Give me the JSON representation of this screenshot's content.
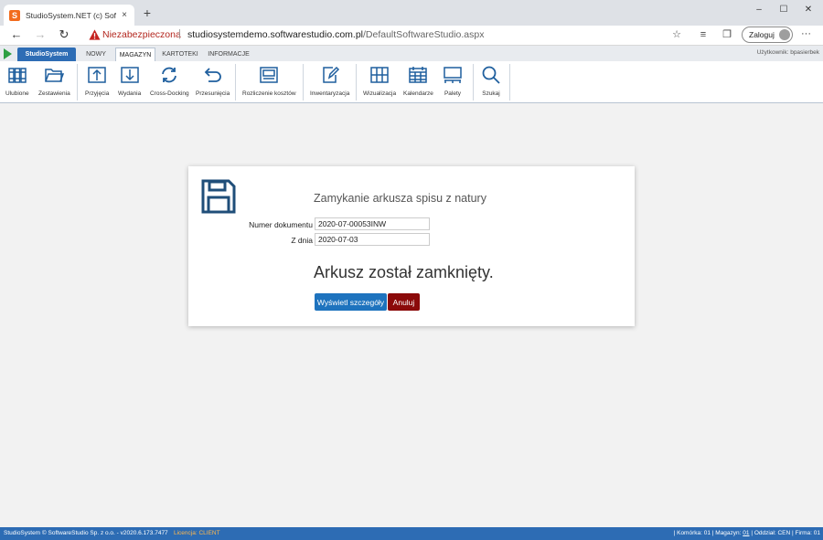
{
  "browser": {
    "tab_title": "StudioSystem.NET (c) SoftwareStudio",
    "tab_close": "×",
    "new_tab": "+",
    "window": {
      "minimize": "–",
      "maximize": "☐",
      "close": "✕"
    },
    "security_label": "Niezabezpieczona",
    "url_separator": "|",
    "url_host": "studiosystemdemo.softwarestudio.com.pl",
    "url_path": "/DefaultSoftwareStudio.aspx",
    "login_label": "Zaloguj",
    "more": "···"
  },
  "app": {
    "tabs": [
      {
        "label": "StudioSystem"
      },
      {
        "label": "NOWY"
      },
      {
        "label": "MAGAZYN"
      },
      {
        "label": "KARTOTEKI"
      },
      {
        "label": "INFORMACJE"
      }
    ],
    "user_label": "Użytkownik: bpasierbek",
    "toolbar": [
      {
        "label": "Ulubione",
        "icon": "books-icon"
      },
      {
        "label": "Zestawienia",
        "icon": "folder-icon"
      },
      {
        "label": "Przyjęcia",
        "icon": "receipt-upload-icon"
      },
      {
        "label": "Wydania",
        "icon": "issue-download-icon"
      },
      {
        "label": "Cross-Docking",
        "icon": "refresh-cycle-icon"
      },
      {
        "label": "Przesunięcia",
        "icon": "return-arrow-icon"
      },
      {
        "label": "Rozliczenie kosztów",
        "icon": "cost-card-icon"
      },
      {
        "label": "Inwentaryzacja",
        "icon": "edit-document-icon"
      },
      {
        "label": "Wizualizacja",
        "icon": "rack-icon"
      },
      {
        "label": "Kalendarze",
        "icon": "calendar-icon"
      },
      {
        "label": "Palety",
        "icon": "pallet-icon"
      },
      {
        "label": "Szukaj",
        "icon": "search-icon"
      }
    ]
  },
  "dialog": {
    "title": "Zamykanie arkusza spisu z natury",
    "doc_number_label": "Numer dokumentu",
    "doc_number_value": "2020-07-00053INW",
    "date_label": "Z dnia",
    "date_value": "2020-07-03",
    "message": "Arkusz został zamknięty.",
    "details_button": "Wyświetl szczegóły",
    "cancel_button": "Anuluj"
  },
  "status": {
    "left": "StudioSystem © SoftwareStudio Sp. z o.o. - v2020.6.173.7477",
    "license": "Licencja: CLIENT",
    "komorka_label": "| Komórka:",
    "komorka_value": "01",
    "magazyn_label": "| Magazyn:",
    "magazyn_value": "01",
    "oddzial_label": "| Oddział:",
    "oddzial_value": "CEN",
    "firma_label": "| Firma:",
    "firma_value": "01"
  },
  "colors": {
    "brand_blue": "#2e6db5",
    "primary_button": "#1e73be",
    "danger_button": "#8b0a0a",
    "icon_blue": "#1f5f9e",
    "insecure_red": "#b3261e"
  }
}
